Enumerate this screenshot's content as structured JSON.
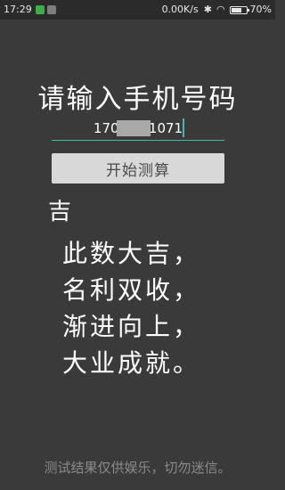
{
  "status_bar": {
    "time": "17:29",
    "network_speed": "0.00K/s",
    "bluetooth_icon": "✱",
    "wifi_icon": "◠",
    "battery_percent": "70%",
    "battery_level": 0.7
  },
  "main": {
    "title": "请输入手机号码",
    "phone_value": "170       1071",
    "calculate_label": "开始测算",
    "verdict": "吉",
    "poem_lines": [
      "此数大吉，",
      "名利双收，",
      "渐进向上，",
      "大业成就。"
    ],
    "disclaimer": "测试结果仅供娱乐，切勿迷信。"
  },
  "colors": {
    "background": "#3a3a3a",
    "accent": "#4db6ac",
    "button": "#d8d8d8",
    "notif_green": "#3fae49",
    "notif_gray": "#7d7d7d"
  }
}
